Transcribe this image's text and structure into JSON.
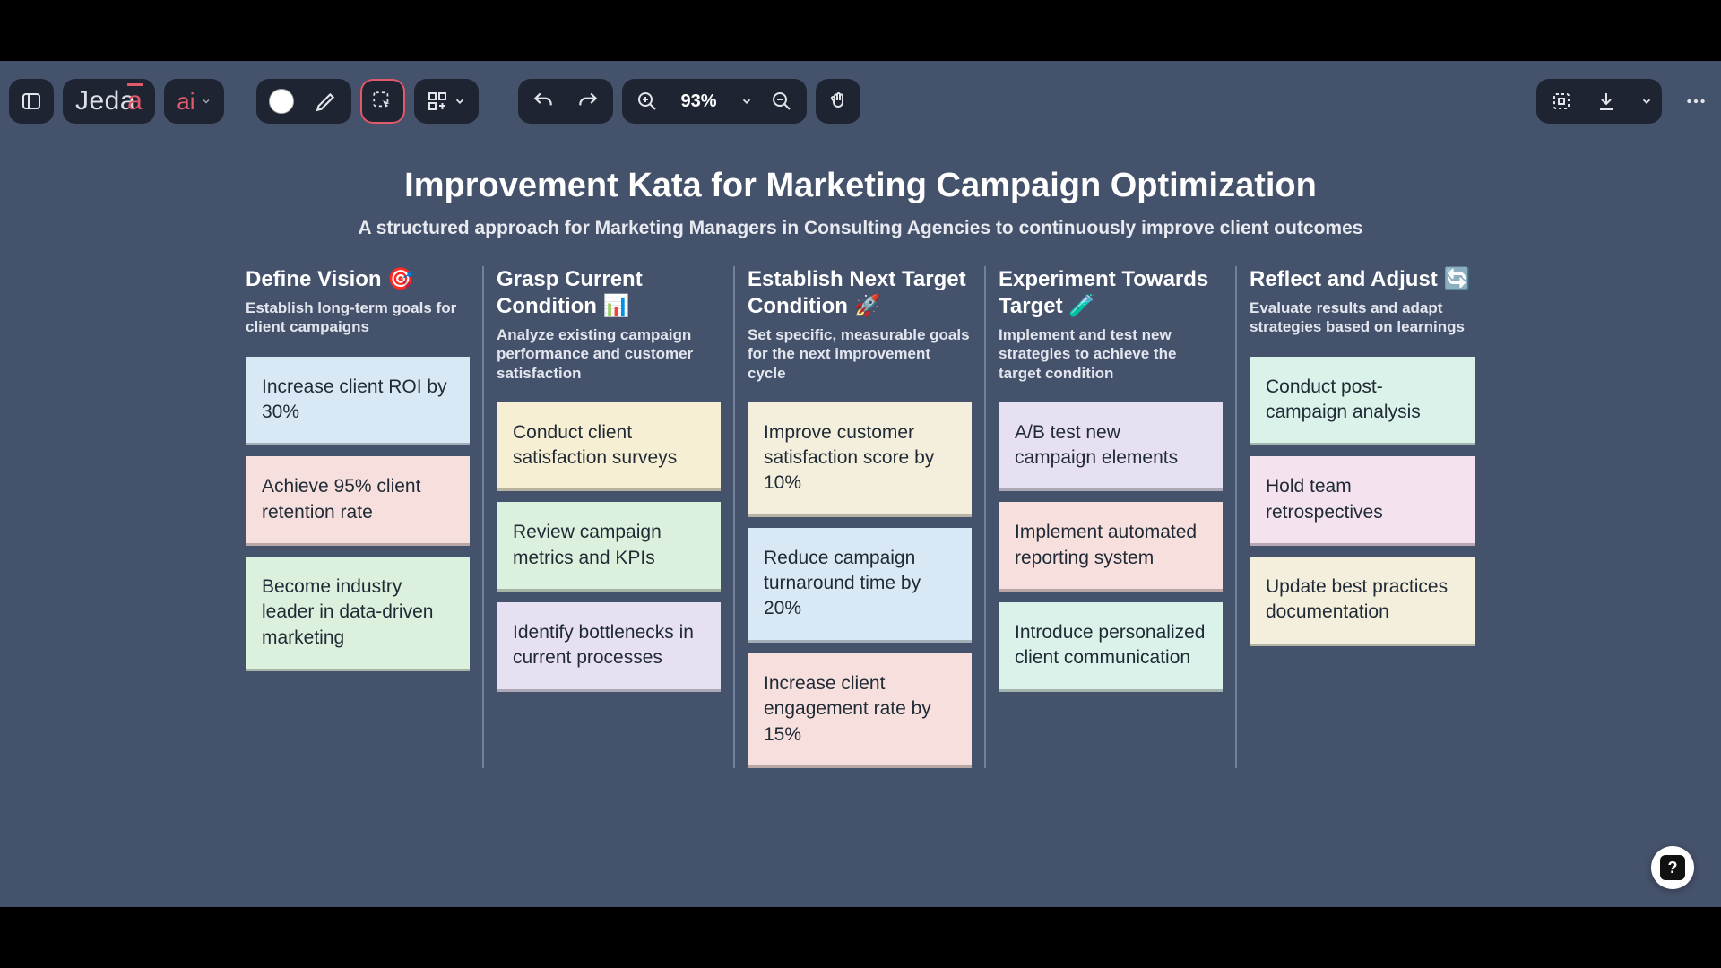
{
  "toolbar": {
    "logo": "Jeda",
    "logo_accent": "a",
    "ai_label": "ai",
    "zoom_label": "93%"
  },
  "canvas": {
    "title": "Improvement Kata for Marketing Campaign Optimization",
    "subtitle": "A structured approach for Marketing Managers in Consulting Agencies to continuously improve client outcomes"
  },
  "columns": [
    {
      "title": "Define Vision 🎯",
      "desc": "Establish long-term goals for client campaigns",
      "cards": [
        {
          "text": "Increase client ROI by 30%",
          "cls": "c-blue"
        },
        {
          "text": "Achieve 95% client retention rate",
          "cls": "c-pink"
        },
        {
          "text": "Become industry leader in data-driven marketing",
          "cls": "c-green"
        }
      ]
    },
    {
      "title": "Grasp Current Condition 📊",
      "desc": "Analyze existing campaign performance and customer satisfaction",
      "cards": [
        {
          "text": "Conduct client satisfaction surveys",
          "cls": "c-yellow"
        },
        {
          "text": "Review campaign metrics and KPIs",
          "cls": "c-green"
        },
        {
          "text": "Identify bottlenecks in current processes",
          "cls": "c-purple"
        }
      ]
    },
    {
      "title": "Establish Next Target Condition 🚀",
      "desc": "Set specific, measurable goals for the next improvement cycle",
      "cards": [
        {
          "text": "Improve customer satisfaction score by 10%",
          "cls": "c-cream"
        },
        {
          "text": "Reduce campaign turnaround time by 20%",
          "cls": "c-blue"
        },
        {
          "text": "Increase client engagement rate by 15%",
          "cls": "c-pink"
        }
      ]
    },
    {
      "title": "Experiment Towards Target 🧪",
      "desc": "Implement and test new strategies to achieve the target condition",
      "cards": [
        {
          "text": "A/B test new campaign elements",
          "cls": "c-purple"
        },
        {
          "text": "Implement automated reporting system",
          "cls": "c-pink"
        },
        {
          "text": "Introduce personalized client communication",
          "cls": "c-mint"
        }
      ]
    },
    {
      "title": "Reflect and Adjust 🔄",
      "desc": "Evaluate results and adapt strategies based on learnings",
      "cards": [
        {
          "text": "Conduct post-campaign analysis",
          "cls": "c-mint"
        },
        {
          "text": "Hold team retrospectives",
          "cls": "c-lpink"
        },
        {
          "text": "Update best practices documentation",
          "cls": "c-cream"
        }
      ]
    }
  ],
  "help": "?"
}
